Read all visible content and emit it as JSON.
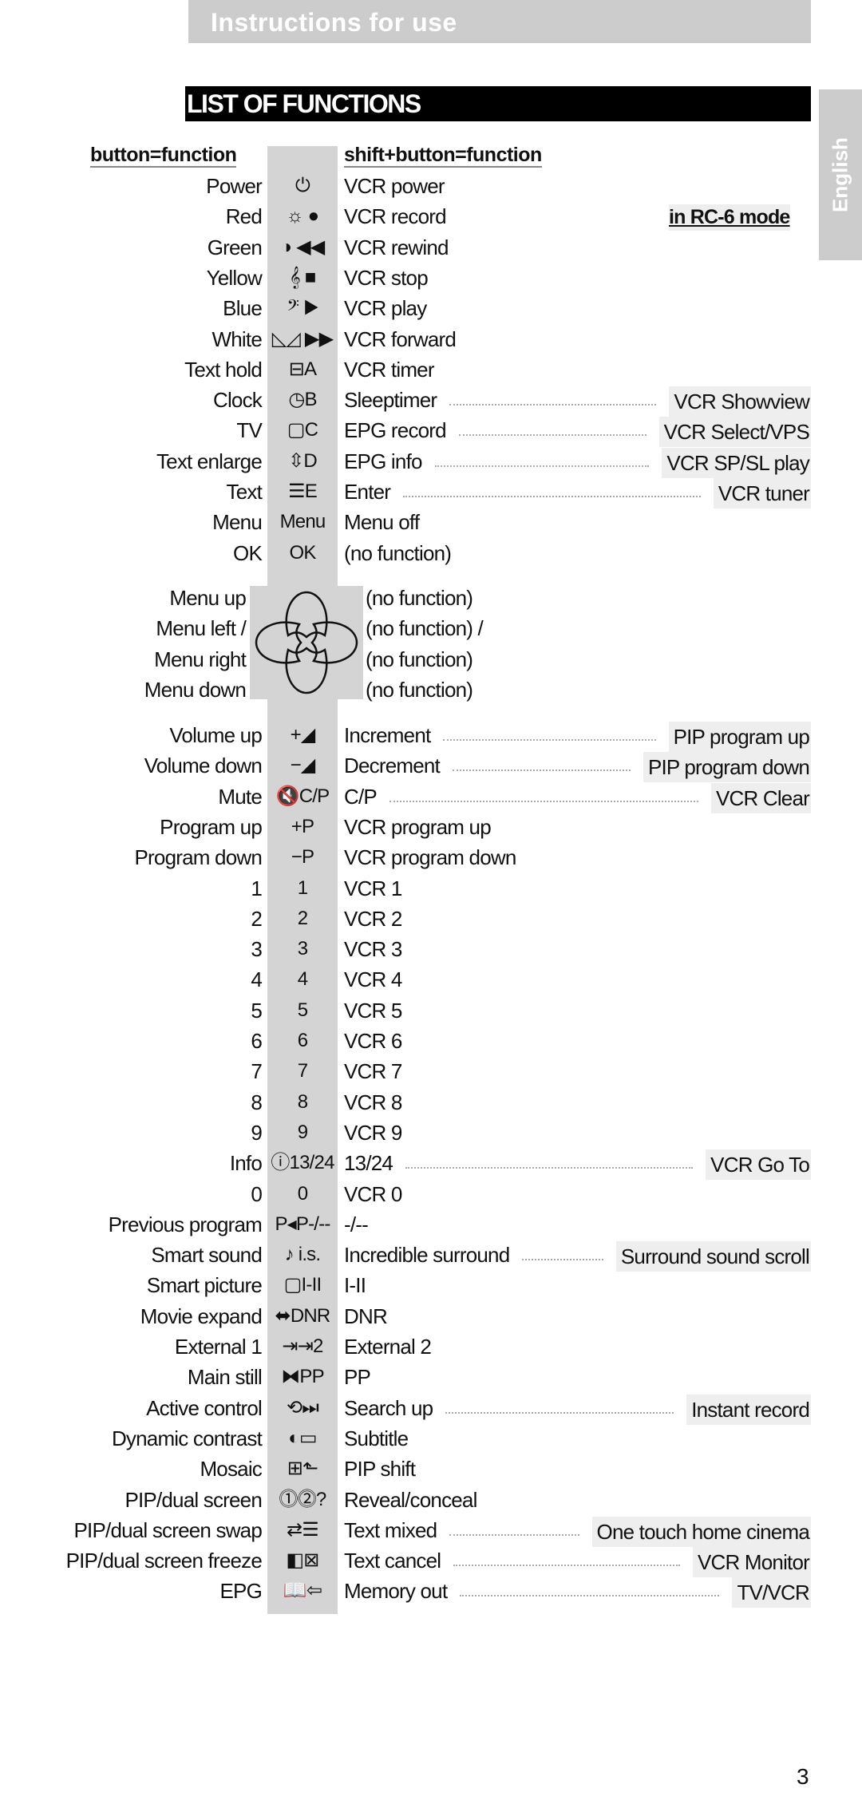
{
  "header": {
    "title": "Instructions for use"
  },
  "section_title": "LIST OF FUNCTIONS",
  "language_tab": "English",
  "columns": {
    "button_function": "button=function",
    "shift_function": "shift+button=function",
    "rc6_mode": "in RC-6 mode"
  },
  "rows_a": [
    {
      "label": "Power",
      "icon": "⏻",
      "icon_name": "power-icon",
      "shift": "VCR power",
      "rc6": ""
    },
    {
      "label": "Red",
      "icon": "☼ ●",
      "icon_name": "brightness-record-icon",
      "shift": "VCR record",
      "rc6": ""
    },
    {
      "label": "Green",
      "icon": "◑ ◀◀",
      "icon_name": "colour-rewind-icon",
      "shift": "VCR rewind",
      "rc6": ""
    },
    {
      "label": "Yellow",
      "icon": "𝄞 ■",
      "icon_name": "treble-stop-icon",
      "shift": "VCR stop",
      "rc6": ""
    },
    {
      "label": "Blue",
      "icon": "𝄢 ▶",
      "icon_name": "bass-play-icon",
      "shift": "VCR play",
      "rc6": ""
    },
    {
      "label": "White",
      "icon": "◺◿ ▶▶",
      "icon_name": "balance-forward-icon",
      "shift": "VCR forward",
      "rc6": ""
    },
    {
      "label": "Text hold",
      "icon": "⊟A",
      "icon_name": "text-hold-icon",
      "shift": "VCR timer",
      "rc6": ""
    },
    {
      "label": "Clock",
      "icon": "◷B",
      "icon_name": "clock-icon",
      "shift": "Sleeptimer",
      "rc6": "VCR Showview"
    },
    {
      "label": "TV",
      "icon": "▢C",
      "icon_name": "tv-icon",
      "shift": "EPG record",
      "rc6": "VCR Select/VPS"
    },
    {
      "label": "Text enlarge",
      "icon": "⇳D",
      "icon_name": "text-enlarge-icon",
      "shift": "EPG info",
      "rc6": "VCR SP/SL play"
    },
    {
      "label": "Text",
      "icon": "☰E",
      "icon_name": "text-icon",
      "shift": "Enter",
      "rc6": "VCR tuner"
    },
    {
      "label": "Menu",
      "icon": "Menu",
      "icon_name": "menu-icon",
      "shift": "Menu off",
      "rc6": ""
    },
    {
      "label": "OK",
      "icon": "OK",
      "icon_name": "ok-icon",
      "shift": "(no function)",
      "rc6": ""
    }
  ],
  "dpad_rows": [
    {
      "label": "Menu up",
      "shift": "(no function)"
    },
    {
      "label": "Menu left /",
      "shift": "(no function) /"
    },
    {
      "label": "Menu right",
      "shift": "(no function)"
    },
    {
      "label": "Menu down",
      "shift": "(no function)"
    }
  ],
  "rows_b": [
    {
      "label": "Volume up",
      "icon": "+◢",
      "icon_name": "volume-up-icon",
      "shift": "Increment",
      "rc6": "PIP program up"
    },
    {
      "label": "Volume down",
      "icon": "−◢",
      "icon_name": "volume-down-icon",
      "shift": "Decrement",
      "rc6": "PIP program down"
    },
    {
      "label": "Mute",
      "icon": "🔇C/P",
      "icon_name": "mute-icon",
      "shift": "C/P",
      "rc6": "VCR Clear"
    },
    {
      "label": "Program up",
      "icon": "+P",
      "icon_name": "program-up-icon",
      "shift": "VCR program up",
      "rc6": ""
    },
    {
      "label": "Program down",
      "icon": "−P",
      "icon_name": "program-down-icon",
      "shift": "VCR program down",
      "rc6": ""
    },
    {
      "label": "1",
      "icon": "1",
      "icon_name": "digit-1-icon",
      "shift": "VCR 1",
      "rc6": ""
    },
    {
      "label": "2",
      "icon": "2",
      "icon_name": "digit-2-icon",
      "shift": "VCR 2",
      "rc6": ""
    },
    {
      "label": "3",
      "icon": "3",
      "icon_name": "digit-3-icon",
      "shift": "VCR 3",
      "rc6": ""
    },
    {
      "label": "4",
      "icon": "4",
      "icon_name": "digit-4-icon",
      "shift": "VCR 4",
      "rc6": ""
    },
    {
      "label": "5",
      "icon": "5",
      "icon_name": "digit-5-icon",
      "shift": "VCR 5",
      "rc6": ""
    },
    {
      "label": "6",
      "icon": "6",
      "icon_name": "digit-6-icon",
      "shift": "VCR 6",
      "rc6": ""
    },
    {
      "label": "7",
      "icon": "7",
      "icon_name": "digit-7-icon",
      "shift": "VCR 7",
      "rc6": ""
    },
    {
      "label": "8",
      "icon": "8",
      "icon_name": "digit-8-icon",
      "shift": "VCR 8",
      "rc6": ""
    },
    {
      "label": "9",
      "icon": "9",
      "icon_name": "digit-9-icon",
      "shift": "VCR 9",
      "rc6": ""
    },
    {
      "label": "Info",
      "icon": "ⓘ13/24",
      "icon_name": "info-icon",
      "shift": "13/24",
      "rc6": "VCR Go To"
    },
    {
      "label": "0",
      "icon": "0",
      "icon_name": "digit-0-icon",
      "shift": "VCR 0",
      "rc6": ""
    },
    {
      "label": "Previous program",
      "icon": "P◂P-/--",
      "icon_name": "previous-program-icon",
      "shift": "-/--",
      "rc6": ""
    },
    {
      "label": "Smart sound",
      "icon": "♪ i.s.",
      "icon_name": "smart-sound-icon",
      "shift": "Incredible surround",
      "rc6": "Surround sound scroll"
    },
    {
      "label": "Smart picture",
      "icon": "▢I-II",
      "icon_name": "smart-picture-icon",
      "shift": "I-II",
      "rc6": ""
    },
    {
      "label": "Movie expand",
      "icon": "⬌DNR",
      "icon_name": "movie-expand-icon",
      "shift": "DNR",
      "rc6": ""
    },
    {
      "label": "External 1",
      "icon": "⇥⇥2",
      "icon_name": "external-icon",
      "shift": "External 2",
      "rc6": ""
    },
    {
      "label": "Main still",
      "icon": "⧓PP",
      "icon_name": "main-still-icon",
      "shift": "PP",
      "rc6": ""
    },
    {
      "label": "Active control",
      "icon": "⟲⏭",
      "icon_name": "active-control-icon",
      "shift": "Search up",
      "rc6": "Instant record"
    },
    {
      "label": "Dynamic contrast",
      "icon": "◐▭",
      "icon_name": "dynamic-contrast-icon",
      "shift": "Subtitle",
      "rc6": ""
    },
    {
      "label": "Mosaic",
      "icon": "⊞⬑",
      "icon_name": "mosaic-icon",
      "shift": "PIP shift",
      "rc6": ""
    },
    {
      "label": "PIP/dual screen",
      "icon": "⓵⓶?",
      "icon_name": "pip-dual-screen-icon",
      "shift": "Reveal/conceal",
      "rc6": ""
    },
    {
      "label": "PIP/dual screen swap",
      "icon": "⇄☰",
      "icon_name": "pip-swap-icon",
      "shift": "Text mixed",
      "rc6": "One touch home cinema"
    },
    {
      "label": "PIP/dual screen freeze",
      "icon": "◧⊠",
      "icon_name": "pip-freeze-icon",
      "shift": "Text cancel",
      "rc6": "VCR Monitor"
    },
    {
      "label": "EPG",
      "icon": "📖⇦",
      "icon_name": "epg-icon",
      "shift": "Memory out",
      "rc6": "TV/VCR"
    }
  ],
  "page_number": "3"
}
